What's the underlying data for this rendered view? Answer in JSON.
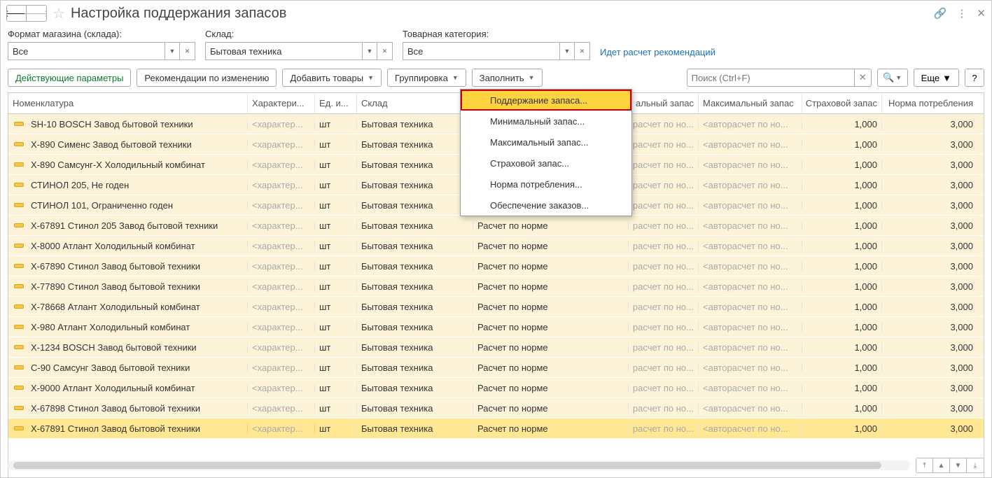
{
  "title": "Настройка поддержания запасов",
  "filters": {
    "format_label": "Формат магазина (склада):",
    "format_value": "Все",
    "warehouse_label": "Склад:",
    "warehouse_value": "Бытовая техника",
    "category_label": "Товарная категория:",
    "category_value": "Все"
  },
  "status_text": "Идет расчет рекомендаций",
  "toolbar": {
    "active_params": "Действующие параметры",
    "recommendations": "Рекомендации по изменению",
    "add_goods": "Добавить товары",
    "grouping": "Группировка",
    "fill": "Заполнить",
    "search_placeholder": "Поиск (Ctrl+F)",
    "more": "Еще",
    "help": "?"
  },
  "dropdown": {
    "items": [
      "Поддержание запаса...",
      "Минимальный запас...",
      "Максимальный запас...",
      "Страховой запас...",
      "Норма потребления...",
      "Обеспечение заказов..."
    ]
  },
  "columns": {
    "nomenclature": "Номенклатура",
    "characteristics": "Характери...",
    "unit": "Ед. и...",
    "warehouse": "Склад",
    "method": "",
    "min": "альный запас",
    "max": "Максимальный запас",
    "safe": "Страховой запас",
    "norm": "Норма потребления"
  },
  "ph_char": "<характер...",
  "auto_min": "расчет по но...",
  "auto_max": "<авторасчет по но...",
  "rows": [
    {
      "name": "SH-10 BOSCH Завод бытовой техники",
      "unit": "шт",
      "wh": "Бытовая техника",
      "method": "",
      "safe": "1,000",
      "norm": "3,000"
    },
    {
      "name": "X-890 Сименс Завод бытовой техники",
      "unit": "шт",
      "wh": "Бытовая техника",
      "method": "",
      "safe": "1,000",
      "norm": "3,000"
    },
    {
      "name": "X-890 Самсунг-X Холодильный комбинат",
      "unit": "шт",
      "wh": "Бытовая техника",
      "method": "",
      "safe": "1,000",
      "norm": "3,000"
    },
    {
      "name": "СТИНОЛ 205, Не годен",
      "unit": "шт",
      "wh": "Бытовая техника",
      "method": "",
      "safe": "1,000",
      "norm": "3,000"
    },
    {
      "name": "СТИНОЛ 101, Ограниченно годен",
      "unit": "шт",
      "wh": "Бытовая техника",
      "method": "",
      "safe": "1,000",
      "norm": "3,000"
    },
    {
      "name": "X-67891 Стинол 205 Завод бытовой техники",
      "unit": "шт",
      "wh": "Бытовая техника",
      "method": "Расчет по норме",
      "safe": "1,000",
      "norm": "3,000"
    },
    {
      "name": "X-8000 Атлант Холодильный комбинат",
      "unit": "шт",
      "wh": "Бытовая техника",
      "method": "Расчет по норме",
      "safe": "1,000",
      "norm": "3,000"
    },
    {
      "name": "X-67890 Стинол Завод бытовой техники",
      "unit": "шт",
      "wh": "Бытовая техника",
      "method": "Расчет по норме",
      "safe": "1,000",
      "norm": "3,000"
    },
    {
      "name": "X-77890 Стинол Завод бытовой техники",
      "unit": "шт",
      "wh": "Бытовая техника",
      "method": "Расчет по норме",
      "safe": "1,000",
      "norm": "3,000"
    },
    {
      "name": "X-78668 Атлант Холодильный комбинат",
      "unit": "шт",
      "wh": "Бытовая техника",
      "method": "Расчет по норме",
      "safe": "1,000",
      "norm": "3,000"
    },
    {
      "name": "X-980 Атлант Холодильный комбинат",
      "unit": "шт",
      "wh": "Бытовая техника",
      "method": "Расчет по норме",
      "safe": "1,000",
      "norm": "3,000"
    },
    {
      "name": "X-1234 BOSCH Завод бытовой техники",
      "unit": "шт",
      "wh": "Бытовая техника",
      "method": "Расчет по норме",
      "safe": "1,000",
      "norm": "3,000"
    },
    {
      "name": "C-90 Самсунг Завод бытовой техники",
      "unit": "шт",
      "wh": "Бытовая техника",
      "method": "Расчет по норме",
      "safe": "1,000",
      "norm": "3,000"
    },
    {
      "name": "X-9000 Атлант Холодильный комбинат",
      "unit": "шт",
      "wh": "Бытовая техника",
      "method": "Расчет по норме",
      "safe": "1,000",
      "norm": "3,000"
    },
    {
      "name": "X-67898 Стинол Завод бытовой техники",
      "unit": "шт",
      "wh": "Бытовая техника",
      "method": "Расчет по норме",
      "safe": "1,000",
      "norm": "3,000"
    },
    {
      "name": "X-67891 Стинол Завод бытовой техники",
      "unit": "шт",
      "wh": "Бытовая техника",
      "method": "Расчет по норме",
      "safe": "1,000",
      "norm": "3,000",
      "sel": true
    }
  ]
}
